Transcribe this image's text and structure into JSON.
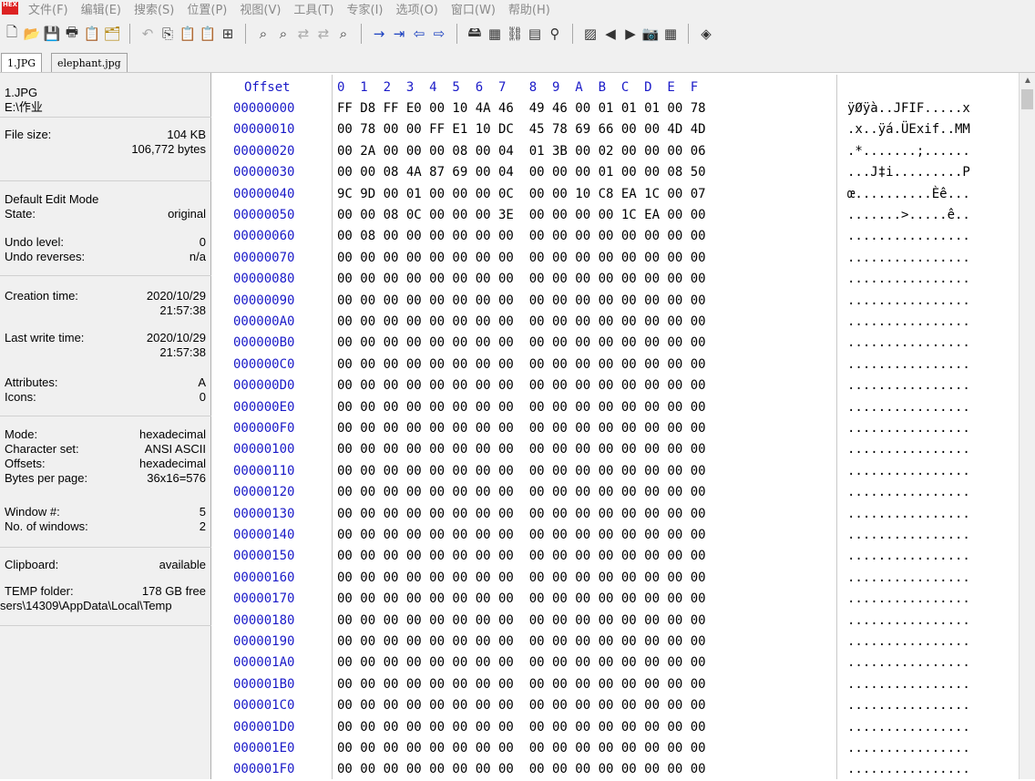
{
  "menu": {
    "app_icon": "HEX",
    "items": [
      "文件(F)",
      "编辑(E)",
      "搜索(S)",
      "位置(P)",
      "视图(V)",
      "工具(T)",
      "专家(I)",
      "选项(O)",
      "窗口(W)",
      "帮助(H)"
    ]
  },
  "toolbar": {
    "groups": [
      [
        {
          "name": "new-file-icon",
          "glyph": "🗋"
        },
        {
          "name": "open-folder-icon",
          "glyph": "📂"
        },
        {
          "name": "save-icon",
          "glyph": "💾"
        },
        {
          "name": "print-icon",
          "glyph": "🖶"
        },
        {
          "name": "properties-icon",
          "glyph": "📋"
        },
        {
          "name": "open-disk-icon",
          "glyph": "🗂"
        }
      ],
      [
        {
          "name": "undo-icon",
          "glyph": "↶"
        },
        {
          "name": "copy-icon",
          "glyph": "⎘"
        },
        {
          "name": "paste-icon",
          "glyph": "📋"
        },
        {
          "name": "paste-special-icon",
          "glyph": "📋"
        },
        {
          "name": "write-hex-icon",
          "glyph": "⊞"
        }
      ],
      [
        {
          "name": "find-icon",
          "glyph": "⌕"
        },
        {
          "name": "find-hex-icon",
          "glyph": "⌕"
        },
        {
          "name": "replace-icon",
          "glyph": "⇄"
        },
        {
          "name": "replace-hex-icon",
          "glyph": "⇄"
        },
        {
          "name": "find-next-icon",
          "glyph": "⌕"
        }
      ],
      [
        {
          "name": "goto-offset-icon",
          "glyph": "→"
        },
        {
          "name": "goto-page-icon",
          "glyph": "⇥"
        },
        {
          "name": "back-icon",
          "glyph": "⇦"
        },
        {
          "name": "forward-icon",
          "glyph": "⇨"
        }
      ],
      [
        {
          "name": "disk-icon",
          "glyph": "🖴"
        },
        {
          "name": "ram-editor-icon",
          "glyph": "▦"
        },
        {
          "name": "link-icon",
          "glyph": "⛓"
        },
        {
          "name": "calculator-icon",
          "glyph": "▤"
        },
        {
          "name": "search-icon",
          "glyph": "⚲"
        }
      ],
      [
        {
          "name": "compare-icon",
          "glyph": "▨"
        },
        {
          "name": "prev-icon",
          "glyph": "◀"
        },
        {
          "name": "next-icon",
          "glyph": "▶"
        },
        {
          "name": "camera-icon",
          "glyph": "📷"
        },
        {
          "name": "grid-icon",
          "glyph": "▦"
        }
      ],
      [
        {
          "name": "bookmark-icon",
          "glyph": "◈"
        }
      ]
    ]
  },
  "tabs": [
    {
      "label": "1.JPG"
    },
    {
      "label": "elephant.jpg"
    }
  ],
  "info": {
    "file_name": "1.JPG",
    "file_path": "E:\\作业",
    "file_size_label": "File size:",
    "file_size_kb": "104 KB",
    "file_size_bytes": "106,772 bytes",
    "edit_mode_label": "Default Edit Mode",
    "state_label": "State:",
    "state_value": "original",
    "undo_level_label": "Undo level:",
    "undo_level_value": "0",
    "undo_reverses_label": "Undo reverses:",
    "undo_reverses_value": "n/a",
    "creation_label": "Creation time:",
    "creation_date": "2020/10/29",
    "creation_time": "21:57:38",
    "last_write_label": "Last write time:",
    "last_write_date": "2020/10/29",
    "last_write_time": "21:57:38",
    "attributes_label": "Attributes:",
    "attributes_value": "A",
    "icons_label": "Icons:",
    "icons_value": "0",
    "mode_label": "Mode:",
    "mode_value": "hexadecimal",
    "charset_label": "Character set:",
    "charset_value": "ANSI ASCII",
    "offsets_label": "Offsets:",
    "offsets_value": "hexadecimal",
    "bpp_label": "Bytes per page:",
    "bpp_value": "36x16=576",
    "window_label": "Window #:",
    "window_value": "5",
    "num_windows_label": "No. of windows:",
    "num_windows_value": "2",
    "clipboard_label": "Clipboard:",
    "clipboard_value": "available",
    "temp_label": "TEMP folder:",
    "temp_value": "178 GB free",
    "temp_path": "sers\\14309\\AppData\\Local\\Temp"
  },
  "hex": {
    "offset_header": "Offset",
    "column_header": "0  1  2  3  4  5  6  7   8  9  A  B  C  D  E  F",
    "rows": [
      {
        "offset": "00000000",
        "bytes": "FF D8 FF E0 00 10 4A 46  49 46 00 01 01 01 00 78",
        "ascii": "ÿØÿà..JFIF.....x"
      },
      {
        "offset": "00000010",
        "bytes": "00 78 00 00 FF E1 10 DC  45 78 69 66 00 00 4D 4D",
        "ascii": ".x..ÿá.ÜExif..MM"
      },
      {
        "offset": "00000020",
        "bytes": "00 2A 00 00 00 08 00 04  01 3B 00 02 00 00 00 06",
        "ascii": ".*.......;......"
      },
      {
        "offset": "00000030",
        "bytes": "00 00 08 4A 87 69 00 04  00 00 00 01 00 00 08 50",
        "ascii": "...J‡i.........P"
      },
      {
        "offset": "00000040",
        "bytes": "9C 9D 00 01 00 00 00 0C  00 00 10 C8 EA 1C 00 07",
        "ascii": "œ..........Èê..."
      },
      {
        "offset": "00000050",
        "bytes": "00 00 08 0C 00 00 00 3E  00 00 00 00 1C EA 00 00",
        "ascii": ".......>.....ê.."
      },
      {
        "offset": "00000060",
        "bytes": "00 08 00 00 00 00 00 00  00 00 00 00 00 00 00 00",
        "ascii": "................"
      },
      {
        "offset": "00000070",
        "bytes": "00 00 00 00 00 00 00 00  00 00 00 00 00 00 00 00",
        "ascii": "................"
      },
      {
        "offset": "00000080",
        "bytes": "00 00 00 00 00 00 00 00  00 00 00 00 00 00 00 00",
        "ascii": "................"
      },
      {
        "offset": "00000090",
        "bytes": "00 00 00 00 00 00 00 00  00 00 00 00 00 00 00 00",
        "ascii": "................"
      },
      {
        "offset": "000000A0",
        "bytes": "00 00 00 00 00 00 00 00  00 00 00 00 00 00 00 00",
        "ascii": "................"
      },
      {
        "offset": "000000B0",
        "bytes": "00 00 00 00 00 00 00 00  00 00 00 00 00 00 00 00",
        "ascii": "................"
      },
      {
        "offset": "000000C0",
        "bytes": "00 00 00 00 00 00 00 00  00 00 00 00 00 00 00 00",
        "ascii": "................"
      },
      {
        "offset": "000000D0",
        "bytes": "00 00 00 00 00 00 00 00  00 00 00 00 00 00 00 00",
        "ascii": "................"
      },
      {
        "offset": "000000E0",
        "bytes": "00 00 00 00 00 00 00 00  00 00 00 00 00 00 00 00",
        "ascii": "................"
      },
      {
        "offset": "000000F0",
        "bytes": "00 00 00 00 00 00 00 00  00 00 00 00 00 00 00 00",
        "ascii": "................"
      },
      {
        "offset": "00000100",
        "bytes": "00 00 00 00 00 00 00 00  00 00 00 00 00 00 00 00",
        "ascii": "................"
      },
      {
        "offset": "00000110",
        "bytes": "00 00 00 00 00 00 00 00  00 00 00 00 00 00 00 00",
        "ascii": "................"
      },
      {
        "offset": "00000120",
        "bytes": "00 00 00 00 00 00 00 00  00 00 00 00 00 00 00 00",
        "ascii": "................"
      },
      {
        "offset": "00000130",
        "bytes": "00 00 00 00 00 00 00 00  00 00 00 00 00 00 00 00",
        "ascii": "................"
      },
      {
        "offset": "00000140",
        "bytes": "00 00 00 00 00 00 00 00  00 00 00 00 00 00 00 00",
        "ascii": "................"
      },
      {
        "offset": "00000150",
        "bytes": "00 00 00 00 00 00 00 00  00 00 00 00 00 00 00 00",
        "ascii": "................"
      },
      {
        "offset": "00000160",
        "bytes": "00 00 00 00 00 00 00 00  00 00 00 00 00 00 00 00",
        "ascii": "................"
      },
      {
        "offset": "00000170",
        "bytes": "00 00 00 00 00 00 00 00  00 00 00 00 00 00 00 00",
        "ascii": "................"
      },
      {
        "offset": "00000180",
        "bytes": "00 00 00 00 00 00 00 00  00 00 00 00 00 00 00 00",
        "ascii": "................"
      },
      {
        "offset": "00000190",
        "bytes": "00 00 00 00 00 00 00 00  00 00 00 00 00 00 00 00",
        "ascii": "................"
      },
      {
        "offset": "000001A0",
        "bytes": "00 00 00 00 00 00 00 00  00 00 00 00 00 00 00 00",
        "ascii": "................"
      },
      {
        "offset": "000001B0",
        "bytes": "00 00 00 00 00 00 00 00  00 00 00 00 00 00 00 00",
        "ascii": "................"
      },
      {
        "offset": "000001C0",
        "bytes": "00 00 00 00 00 00 00 00  00 00 00 00 00 00 00 00",
        "ascii": "................"
      },
      {
        "offset": "000001D0",
        "bytes": "00 00 00 00 00 00 00 00  00 00 00 00 00 00 00 00",
        "ascii": "................"
      },
      {
        "offset": "000001E0",
        "bytes": "00 00 00 00 00 00 00 00  00 00 00 00 00 00 00 00",
        "ascii": "................"
      },
      {
        "offset": "000001F0",
        "bytes": "00 00 00 00 00 00 00 00  00 00 00 00 00 00 00 00",
        "ascii": "................"
      }
    ]
  },
  "colors": {
    "offset_blue": "#1a1ac8",
    "panel_bg": "#f0f0f0"
  }
}
